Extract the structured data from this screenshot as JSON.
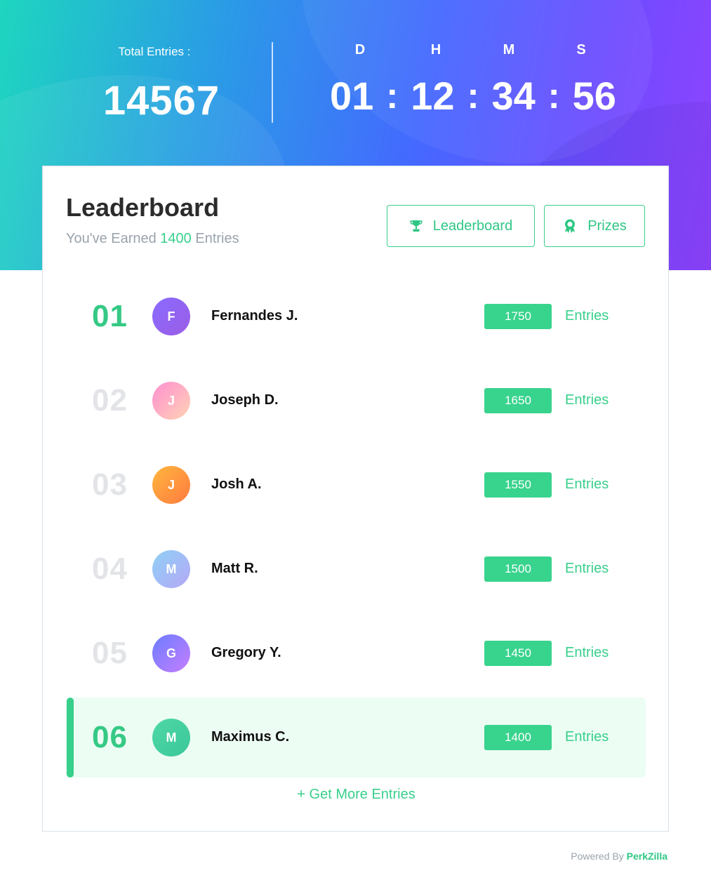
{
  "hero": {
    "total_label": "Total Entries :",
    "total_value": "14567",
    "countdown": {
      "labels": {
        "d": "D",
        "h": "H",
        "m": "M",
        "s": "S"
      },
      "values": {
        "d": "01",
        "h": "12",
        "m": "34",
        "s": "56"
      },
      "separator": ":"
    }
  },
  "card": {
    "title": "Leaderboard",
    "subtitle_prefix": "You've Earned ",
    "subtitle_value": "1400",
    "subtitle_suffix": " Entries",
    "tabs": {
      "leaderboard": "Leaderboard",
      "prizes": "Prizes"
    },
    "rows": [
      {
        "rank": "01",
        "initial": "F",
        "name": "Fernandes J.",
        "entries": "1750",
        "entries_label": "Entries",
        "avatar_colors": [
          "#8a6bff",
          "#9b5de5"
        ]
      },
      {
        "rank": "02",
        "initial": "J",
        "name": "Joseph D.",
        "entries": "1650",
        "entries_label": "Entries",
        "avatar_colors": [
          "#ff8fd0",
          "#ffd3b5"
        ]
      },
      {
        "rank": "03",
        "initial": "J",
        "name": "Josh A.",
        "entries": "1550",
        "entries_label": "Entries",
        "avatar_colors": [
          "#ffb640",
          "#ff7b3d"
        ]
      },
      {
        "rank": "04",
        "initial": "M",
        "name": "Matt R.",
        "entries": "1500",
        "entries_label": "Entries",
        "avatar_colors": [
          "#8fd0f7",
          "#b5a8f5"
        ]
      },
      {
        "rank": "05",
        "initial": "G",
        "name": "Gregory Y.",
        "entries": "1450",
        "entries_label": "Entries",
        "avatar_colors": [
          "#6a7dff",
          "#c77dff"
        ]
      },
      {
        "rank": "06",
        "initial": "M",
        "name": "Maximus C.",
        "entries": "1400",
        "entries_label": "Entries",
        "avatar_colors": [
          "#4fd8a6",
          "#3bc79a"
        ]
      }
    ],
    "more_link": "+ Get More Entries"
  },
  "footer": {
    "powered_prefix": "Powered By ",
    "brand": "PerkZilla"
  },
  "colors": {
    "accent": "#38cf8b",
    "rank_muted": "#e2e4e7",
    "highlight_row": "#ecfdf4"
  }
}
